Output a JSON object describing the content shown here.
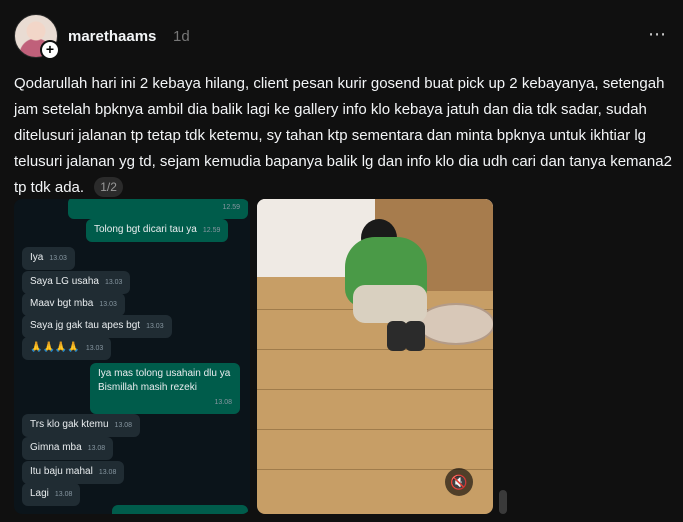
{
  "post": {
    "username": "marethaams",
    "time": "1d",
    "more_icon": "⋯",
    "caption": "Qodarullah hari ini 2 kebaya hilang, client pesan kurir gosend buat pick up 2 kebayanya, setengah jam setelah bpknya ambil dia balik lagi ke gallery info klo kebaya jatuh dan dia tdk sadar, sudah ditelusuri jalanan tp tetap tdk ketemu, sy tahan ktp sementara dan minta bpknya untuk ikhtiar lg telusuri jalanan yg td, sejam kemudia bapanya balik lg dan info klo dia udh cari dan tanya kemana2 tp tdk ada.",
    "media_counter": "1/2"
  },
  "chat": {
    "messages": [
      {
        "type": "sent",
        "text": "",
        "time": "12.59"
      },
      {
        "type": "sent",
        "text": "Tolong bgt dicari tau ya",
        "time": "12.59"
      },
      {
        "type": "recv",
        "text": "Iya",
        "time": "13.03"
      },
      {
        "type": "recv",
        "text": "Saya LG usaha",
        "time": "13.03"
      },
      {
        "type": "recv",
        "text": "Maav bgt mba",
        "time": "13.03"
      },
      {
        "type": "recv",
        "text": "Saya jg gak tau apes bgt",
        "time": "13.03"
      },
      {
        "type": "recv",
        "text": "🙏🙏🙏🙏",
        "time": "13.03"
      },
      {
        "type": "sent",
        "text": "Iya mas tolong usahain dlu ya",
        "time": ""
      },
      {
        "type": "sent",
        "text": "Bismillah masih rezeki",
        "time": "13.08"
      },
      {
        "type": "recv",
        "text": "Trs klo gak ktemu",
        "time": "13.08"
      },
      {
        "type": "recv",
        "text": "Gimna mba",
        "time": "13.08"
      },
      {
        "type": "recv",
        "text": "Itu baju mahal",
        "time": "13.08"
      },
      {
        "type": "recv",
        "text": "Lagi",
        "time": "13.08"
      }
    ]
  },
  "video": {
    "mute_icon": "🔇"
  }
}
